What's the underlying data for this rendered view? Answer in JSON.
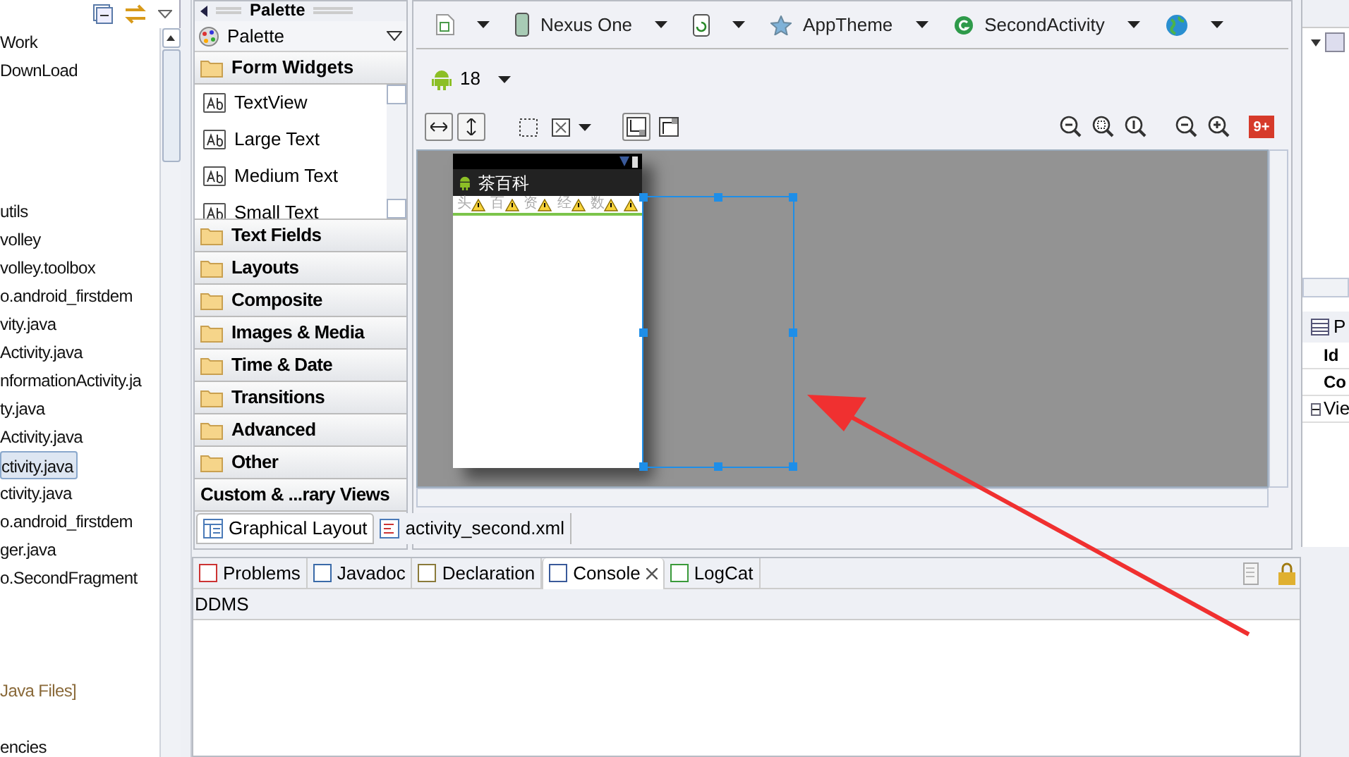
{
  "explorer": {
    "sections": [
      [
        {
          "label": "Work",
          "selected": false
        },
        {
          "label": "DownLoad",
          "selected": false
        }
      ],
      [
        {
          "label": "utils",
          "selected": false
        },
        {
          "label": "volley",
          "selected": false
        },
        {
          "label": "volley.toolbox",
          "selected": false
        },
        {
          "label": "o.android_firstdem",
          "selected": false
        },
        {
          "label": "vity.java",
          "selected": false
        },
        {
          "label": "Activity.java",
          "selected": false
        },
        {
          "label": "nformationActivity.ja",
          "selected": false
        },
        {
          "label": "ty.java",
          "selected": false
        },
        {
          "label": "Activity.java",
          "selected": false
        },
        {
          "label": "ctivity.java",
          "selected": true
        },
        {
          "label": "ctivity.java",
          "selected": false
        },
        {
          "label": "o.android_firstdem",
          "selected": false
        },
        {
          "label": "ger.java",
          "selected": false
        },
        {
          "label": "o.SecondFragment",
          "selected": false
        }
      ],
      [
        {
          "label": "Java Files]",
          "selected": false
        }
      ],
      [
        {
          "label": "encies",
          "selected": false
        }
      ]
    ]
  },
  "palette": {
    "title": "Palette",
    "selector": "Palette",
    "open_category": {
      "label": "Form Widgets",
      "items": [
        "TextView",
        "Large Text",
        "Medium Text",
        "Small Text"
      ]
    },
    "categories": [
      {
        "label": "Text Fields",
        "kind": "folder"
      },
      {
        "label": "Layouts",
        "kind": "folder"
      },
      {
        "label": "Composite",
        "kind": "folder"
      },
      {
        "label": "Images & Media",
        "kind": "folder"
      },
      {
        "label": "Time & Date",
        "kind": "folder"
      },
      {
        "label": "Transitions",
        "kind": "folder"
      },
      {
        "label": "Advanced",
        "kind": "folder"
      },
      {
        "label": "Other",
        "kind": "folder"
      },
      {
        "label": "Custom & ...rary Views",
        "kind": "plain"
      }
    ]
  },
  "config_bar": [
    {
      "kind": "layout"
    },
    {
      "kind": "device",
      "label": "Nexus One"
    },
    {
      "kind": "orientation"
    },
    {
      "kind": "theme",
      "label": "AppTheme"
    },
    {
      "kind": "activity",
      "label": "SecondActivity"
    },
    {
      "kind": "locale"
    }
  ],
  "api_level": "18",
  "zoom_badge": "9+",
  "phone": {
    "app_title": "茶百科",
    "tabs": [
      "头",
      "百",
      "资",
      "经",
      "数"
    ]
  },
  "editor_tabs": [
    {
      "label": "Graphical Layout",
      "selected": true
    },
    {
      "label": "activity_second.xml",
      "selected": false
    }
  ],
  "bottom_tabs": [
    {
      "label": "Problems",
      "selected": false
    },
    {
      "label": "Javadoc",
      "selected": false
    },
    {
      "label": "Declaration",
      "selected": false
    },
    {
      "label": "Console",
      "selected": true
    },
    {
      "label": "LogCat",
      "selected": false
    }
  ],
  "console_title": "DDMS",
  "properties": {
    "tab": "P",
    "rows": [
      "Id",
      "Co"
    ],
    "group": {
      "label": "Vie",
      "expanded": true
    }
  }
}
